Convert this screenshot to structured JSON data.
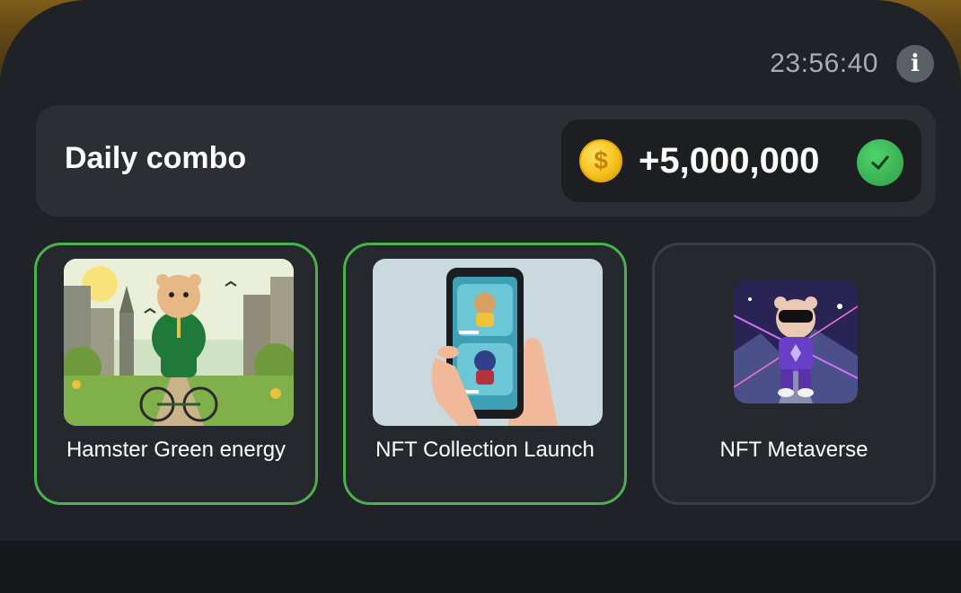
{
  "header": {
    "timer": "23:56:40",
    "info_icon": "info-icon"
  },
  "combo": {
    "title": "Daily combo",
    "reward": "+5,000,000",
    "coin_symbol": "$",
    "coin_icon": "coin-icon",
    "status_icon": "checkmark-icon"
  },
  "cards": [
    {
      "label": "Hamster Green energy",
      "image": "hamster-riding-bicycle-image",
      "completed": true
    },
    {
      "label": "NFT Collection Launch",
      "image": "phone-nft-collection-image",
      "completed": true
    },
    {
      "label": "NFT Metaverse",
      "image": "hamster-metaverse-image",
      "completed": false
    }
  ],
  "colors": {
    "accent_green": "#4caf50",
    "coin_gold": "#f7c21c",
    "timer_grey": "#a8adb3"
  }
}
